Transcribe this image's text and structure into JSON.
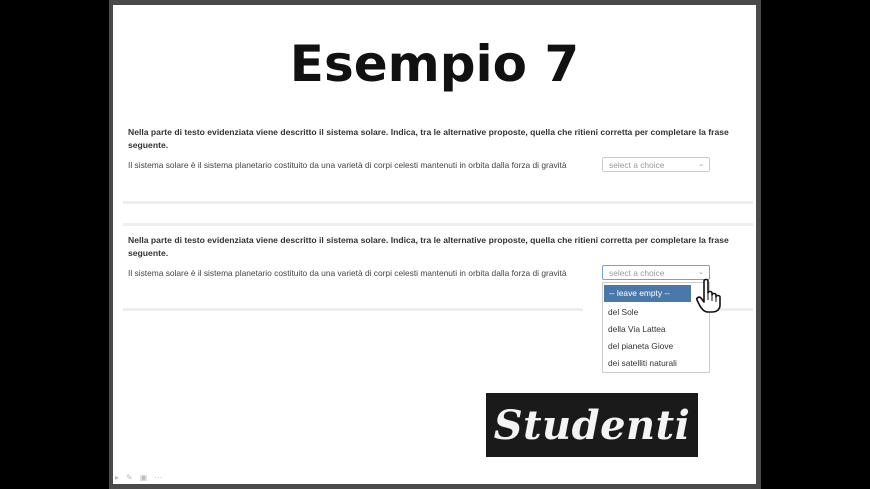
{
  "slide": {
    "title": "Esempio 7"
  },
  "question1": {
    "prompt": "Nella parte di testo evidenziata viene descritto il sistema solare. Indica, tra le alternative proposte, quella che ritieni corretta per completare la frase seguente.",
    "sentence": "Il sistema solare è il sistema planetario costituito da una varietà di corpi celesti mantenuti in orbita dalla forza di gravità",
    "select_placeholder": "select a choice"
  },
  "question2": {
    "prompt": "Nella parte di testo evidenziata viene descritto il sistema solare. Indica, tra le alternative proposte, quella che ritieni corretta per completare la frase seguente.",
    "sentence": "Il sistema solare è il sistema planetario costituito da una varietà di corpi celesti mantenuti in orbita dalla forza di gravità",
    "select_placeholder": "select a choice",
    "options": [
      "-- leave empty --",
      "del Sole",
      "della Via Lattea",
      "del pianeta Giove",
      "dei satelliti naturali"
    ]
  },
  "logo": {
    "text": "Studenti"
  },
  "icons": {
    "pointer": "hand-pointer-icon",
    "chevron": "chevron-down-icon"
  }
}
